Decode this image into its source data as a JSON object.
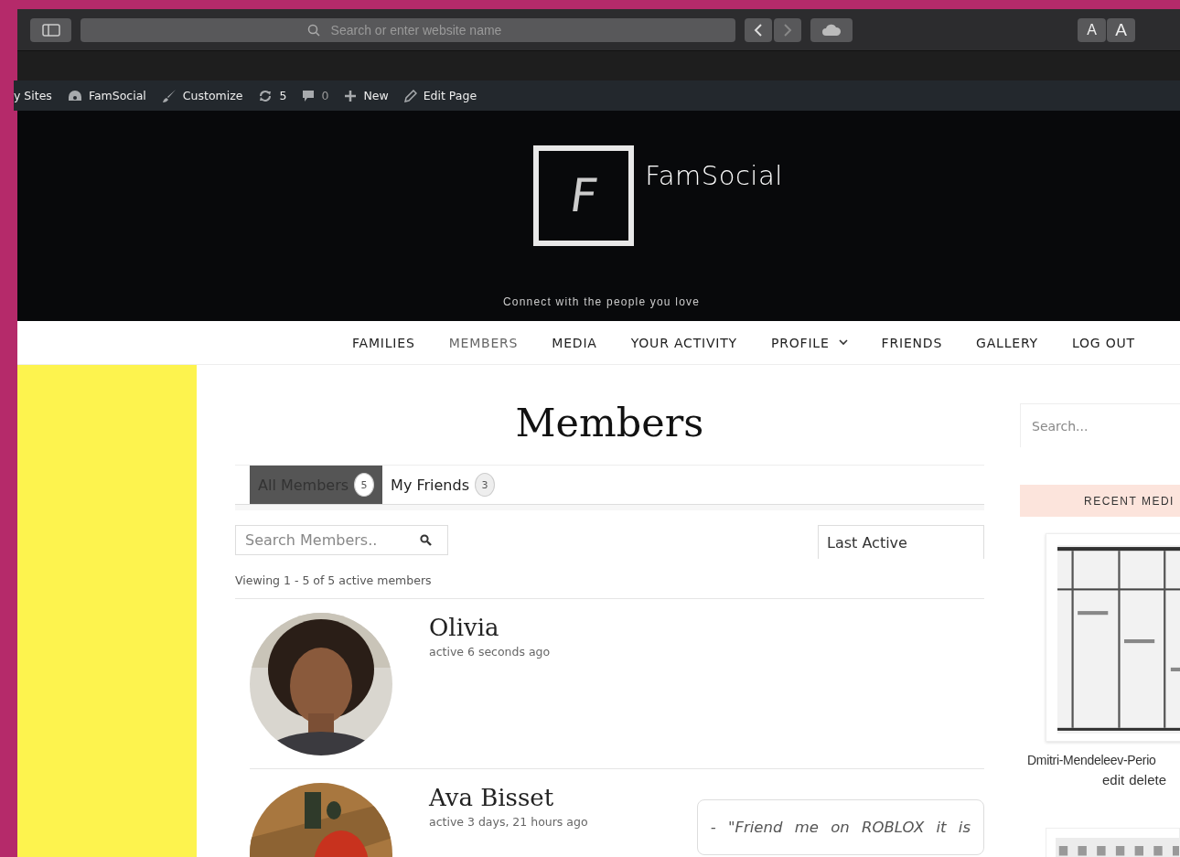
{
  "browser": {
    "address_placeholder": "Search or enter website name",
    "font_buttons": [
      "A",
      "A"
    ]
  },
  "admin_bar": [
    {
      "kind": "text",
      "label": "y Sites"
    },
    {
      "kind": "dashboard",
      "label": "FamSocial"
    },
    {
      "kind": "brush",
      "label": "Customize"
    },
    {
      "kind": "updates",
      "label": "5"
    },
    {
      "kind": "comments",
      "label": "0"
    },
    {
      "kind": "new",
      "label": "New"
    },
    {
      "kind": "edit",
      "label": "Edit Page"
    }
  ],
  "site": {
    "logo_letter": "F",
    "title": "FamSocial",
    "tagline": "Connect with the people you love"
  },
  "nav": [
    {
      "label": "FAMILIES",
      "selected": false,
      "dropdown": false
    },
    {
      "label": "MEMBERS",
      "selected": true,
      "dropdown": false
    },
    {
      "label": "MEDIA",
      "selected": false,
      "dropdown": false
    },
    {
      "label": "YOUR ACTIVITY",
      "selected": false,
      "dropdown": false
    },
    {
      "label": "PROFILE",
      "selected": false,
      "dropdown": true
    },
    {
      "label": "FRIENDS",
      "selected": false,
      "dropdown": false
    },
    {
      "label": "GALLERY",
      "selected": false,
      "dropdown": false
    },
    {
      "label": "LOG OUT",
      "selected": false,
      "dropdown": false
    }
  ],
  "page_title": "Members",
  "tabs": [
    {
      "label": "All Members",
      "count": "5",
      "selected": true
    },
    {
      "label": "My Friends",
      "count": "3",
      "selected": false
    }
  ],
  "member_search": {
    "placeholder": "Search Members.."
  },
  "order_by": {
    "value": "Last Active"
  },
  "viewing": "Viewing 1 - 5 of 5 active members",
  "members": [
    {
      "name": "Olivia",
      "activity": "active 6 seconds ago"
    },
    {
      "name": "Ava Bisset",
      "activity": "active 3 days, 21 hours ago",
      "quote": "- \"Friend me on ROBLOX it is"
    }
  ],
  "sidebar": {
    "search_placeholder": "Search...",
    "widget_title": "RECENT MEDI",
    "media": [
      {
        "caption": "Dmitri-Mendeleev-Perio",
        "actions": [
          "edit",
          "delete"
        ]
      }
    ]
  }
}
